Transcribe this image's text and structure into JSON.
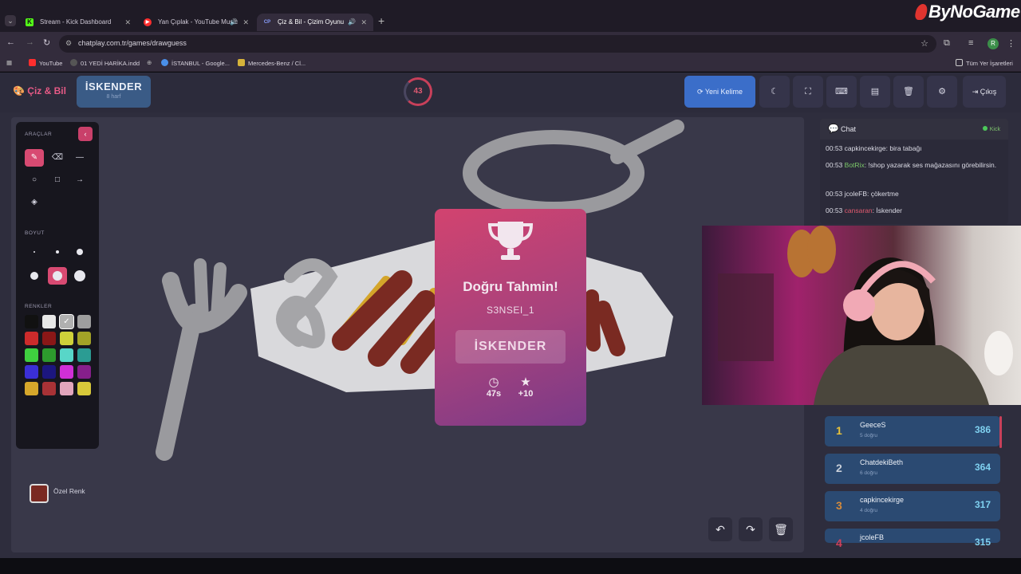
{
  "browser": {
    "tabs": [
      {
        "label": "Stream - Kick Dashboard",
        "favicon": "K",
        "favicon_color": "#53fc18"
      },
      {
        "label": "Yan Çıplak - YouTube Music",
        "favicon": "▶",
        "favicon_color": "#ff2e2e"
      },
      {
        "label": "Çiz & Bil - Çizim Oyunu",
        "favicon": "CP",
        "favicon_color": "#8aa0ff"
      }
    ],
    "url": "chatplay.com.tr/games/drawguess",
    "bookmarks": [
      "YouTube",
      "01 YEDİ HARİKA.indd",
      "İSTANBUL - Google...",
      "Mercedes-Benz / Cl...",
      "Tüm Yer İşaretleri"
    ],
    "profile_letter": "R",
    "overlay_brand": "ByNoGame"
  },
  "header": {
    "logo": "Çiz & Bil",
    "word": "İSKENDER",
    "word_hint": "8 harf",
    "timer": "43",
    "new_word": "Yeni Kelime",
    "exit": "Çıkış"
  },
  "tools": {
    "title": "ARAÇLAR",
    "size_title": "BOYUT",
    "colors_title": "RENKLER",
    "custom_label": "Özel Renk",
    "colors": [
      "#111111",
      "#e8e8e8",
      "#b0b0b0",
      "#9e9e9e",
      "#cc2b2b",
      "#8a1717",
      "#cfd13a",
      "#a3a327",
      "#3fcf3f",
      "#2d9a2d",
      "#58d6c8",
      "#2b9c93",
      "#3b2fd6",
      "#1c167f",
      "#d02fd6",
      "#861f8b",
      "#d6a72b",
      "#a83236",
      "#e2a6bd",
      "#d8c93a"
    ]
  },
  "modal": {
    "title": "Doğru Tahmin!",
    "player": "S3NSEI_1",
    "answer": "İSKENDER",
    "time": "47s",
    "points": "+10"
  },
  "chat": {
    "title": "Chat",
    "platform": "Kick",
    "messages": [
      {
        "time": "00:53",
        "user": "capkincekirge",
        "text": "bira tabağı"
      },
      {
        "time": "00:53",
        "user": "BotRix",
        "text": "!shop yazarak ses mağazasını görebilirsin."
      },
      {
        "time": "00:53",
        "user": "jcoleFB",
        "text": "çökertme"
      },
      {
        "time": "00:53",
        "user": "cansaran",
        "text": "İskender"
      }
    ]
  },
  "leaderboard": [
    {
      "rank": "1",
      "name": "GeeceS",
      "sub": "5 doğru",
      "score": "386",
      "rank_color": "#e8c23a"
    },
    {
      "rank": "2",
      "name": "ChatdekiBeth",
      "sub": "6 doğru",
      "score": "364",
      "rank_color": "#c9d0da"
    },
    {
      "rank": "3",
      "name": "capkincekirge",
      "sub": "4 doğru",
      "score": "317",
      "rank_color": "#d58a3a"
    },
    {
      "rank": "4",
      "name": "jcoleFB",
      "sub": "",
      "score": "315",
      "rank_color": "#d0405a"
    }
  ]
}
